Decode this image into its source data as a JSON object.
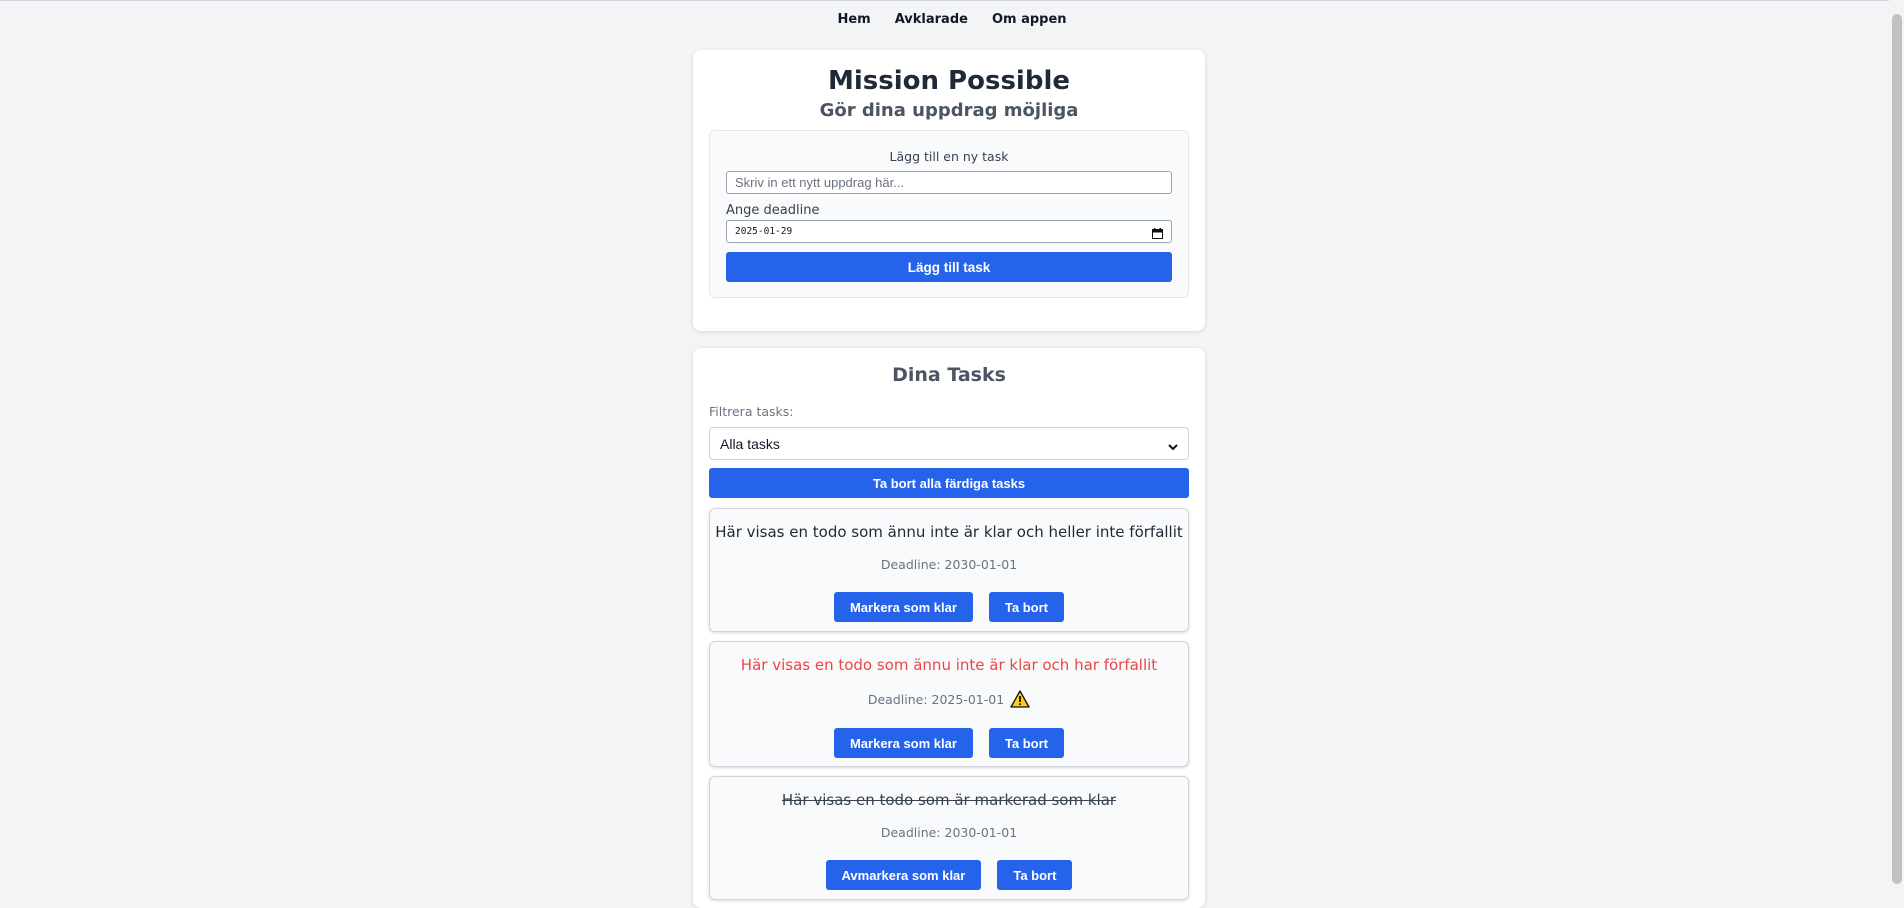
{
  "nav": {
    "items": [
      "Hem",
      "Avklarade",
      "Om appen"
    ]
  },
  "header": {
    "title": "Mission Possible",
    "subtitle": "Gör dina uppdrag möjliga"
  },
  "add_form": {
    "heading": "Lägg till en ny task",
    "task_placeholder": "Skriv in ett nytt uppdrag här...",
    "deadline_label": "Ange deadline",
    "deadline_value": "2025-01-29",
    "submit_label": "Lägg till task"
  },
  "tasks_section": {
    "title": "Dina Tasks",
    "filter_label": "Filtrera tasks:",
    "filter_selected": "Alla tasks",
    "clear_done_label": "Ta bort alla färdiga tasks",
    "tasks": [
      {
        "text": "Här visas en todo som ännu inte är klar och heller inte förfallit",
        "deadline": "Deadline: 2030-01-01",
        "toggle_label": "Markera som klar",
        "delete_label": "Ta bort",
        "status": "active"
      },
      {
        "text": "Här visas en todo som ännu inte är klar och har förfallit",
        "deadline": "Deadline: 2025-01-01",
        "toggle_label": "Markera som klar",
        "delete_label": "Ta bort",
        "status": "overdue",
        "icon": "warning-icon"
      },
      {
        "text": "Här visas en todo som är markerad som klar",
        "deadline": "Deadline: 2030-01-01",
        "toggle_label": "Avmarkera som klar",
        "delete_label": "Ta bort",
        "status": "done"
      }
    ]
  },
  "colors": {
    "accent": "#2563eb",
    "overdue": "#ef4444",
    "background": "#f3f4f6"
  }
}
